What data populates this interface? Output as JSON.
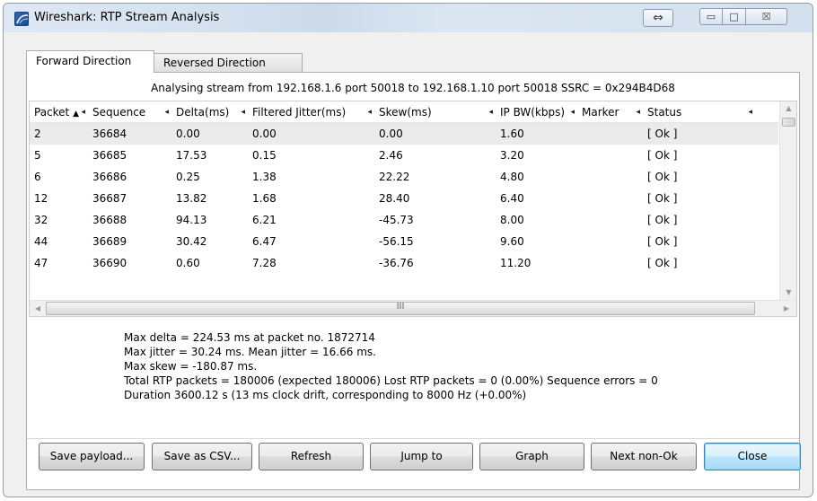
{
  "window": {
    "title": "Wireshark: RTP Stream Analysis",
    "snap_icon": "⇔",
    "min_icon": "▭",
    "max_icon": "□",
    "close_icon": "☒"
  },
  "tabs": [
    {
      "label": "Forward Direction",
      "active": true
    },
    {
      "label": "Reversed Direction",
      "active": false
    }
  ],
  "analysing_text": "Analysing stream from  192.168.1.6 port 50018  to  192.168.1.10 port 50018   SSRC = 0x294B4D68",
  "table": {
    "columns": [
      "Packet",
      "Sequence",
      "Delta(ms)",
      "Filtered Jitter(ms)",
      "Skew(ms)",
      "IP BW(kbps)",
      "Marker",
      "Status",
      ""
    ],
    "sort_column": "Packet",
    "rows": [
      [
        "2",
        "36684",
        "0.00",
        "0.00",
        "0.00",
        "1.60",
        "",
        "[ Ok ]"
      ],
      [
        "5",
        "36685",
        "17.53",
        "0.15",
        "2.46",
        "3.20",
        "",
        "[ Ok ]"
      ],
      [
        "6",
        "36686",
        "0.25",
        "1.38",
        "22.22",
        "4.80",
        "",
        "[ Ok ]"
      ],
      [
        "12",
        "36687",
        "13.82",
        "1.68",
        "28.40",
        "6.40",
        "",
        "[ Ok ]"
      ],
      [
        "32",
        "36688",
        "94.13",
        "6.21",
        "-45.73",
        "8.00",
        "",
        "[ Ok ]"
      ],
      [
        "44",
        "36689",
        "30.42",
        "6.47",
        "-56.15",
        "9.60",
        "",
        "[ Ok ]"
      ],
      [
        "47",
        "36690",
        "0.60",
        "7.28",
        "-36.76",
        "11.20",
        "",
        "[ Ok ]"
      ]
    ],
    "selected_row": 0,
    "hscroll_grip": "III"
  },
  "stats": [
    "Max delta = 224.53 ms at packet no. 1872714",
    "Max jitter = 30.24 ms. Mean jitter = 16.66 ms.",
    "Max skew = -180.87 ms.",
    "Total RTP packets = 180006   (expected 180006)   Lost RTP packets = 0 (0.00%)   Sequence errors = 0",
    "Duration 3600.12 s (13 ms clock drift, corresponding to 8000 Hz (+0.00%)"
  ],
  "buttons": {
    "save_payload": "Save payload...",
    "save_csv": "Save as CSV...",
    "refresh": "Refresh",
    "jump_to": "Jump to",
    "graph": "Graph",
    "next_non_ok": "Next non-Ok",
    "close": "Close"
  },
  "colors": {
    "titlebar": "#d5e1ef",
    "selected_row": "#ebebeb",
    "default_button": "#bee6fd"
  }
}
